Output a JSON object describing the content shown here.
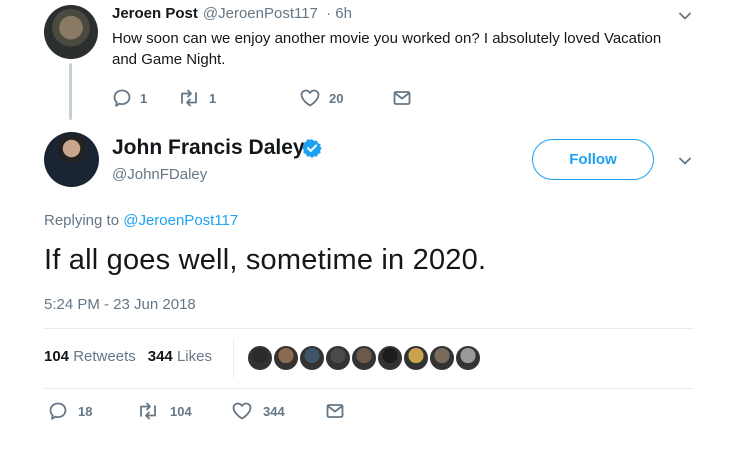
{
  "parent_tweet": {
    "name": "Jeroen Post",
    "handle": "@JeroenPost117",
    "time": "· 6h",
    "text": "How soon can we enjoy another movie you worked on? I absolutely loved Vacation and Game Night.",
    "actions": {
      "replies": "1",
      "retweets": "1",
      "likes": "20"
    }
  },
  "main_tweet": {
    "name": "John Francis Daley",
    "handle": "@JohnFDaley",
    "follow_label": "Follow",
    "replying_prefix": "Replying to ",
    "replying_to": "@JeroenPost117",
    "text": "If all goes well, sometime in 2020.",
    "timestamp": "5:24 PM - 23 Jun 2018",
    "stats": {
      "retweets_count": "104",
      "retweets_label": "Retweets",
      "likes_count": "344",
      "likes_label": "Likes"
    },
    "liker_colors": [
      "#2b2b2b",
      "#8c6a4f",
      "#3d5566",
      "#4a4a4a",
      "#6b5a4a",
      "#1c1c1c",
      "#c9a44a",
      "#7a6a5a",
      "#9a9a9a"
    ],
    "actions": {
      "replies": "18",
      "retweets": "104",
      "likes": "344"
    }
  },
  "colors": {
    "accent": "#1da1f2",
    "muted": "#657786",
    "text": "#14171a",
    "verified": "#1da1f2"
  }
}
